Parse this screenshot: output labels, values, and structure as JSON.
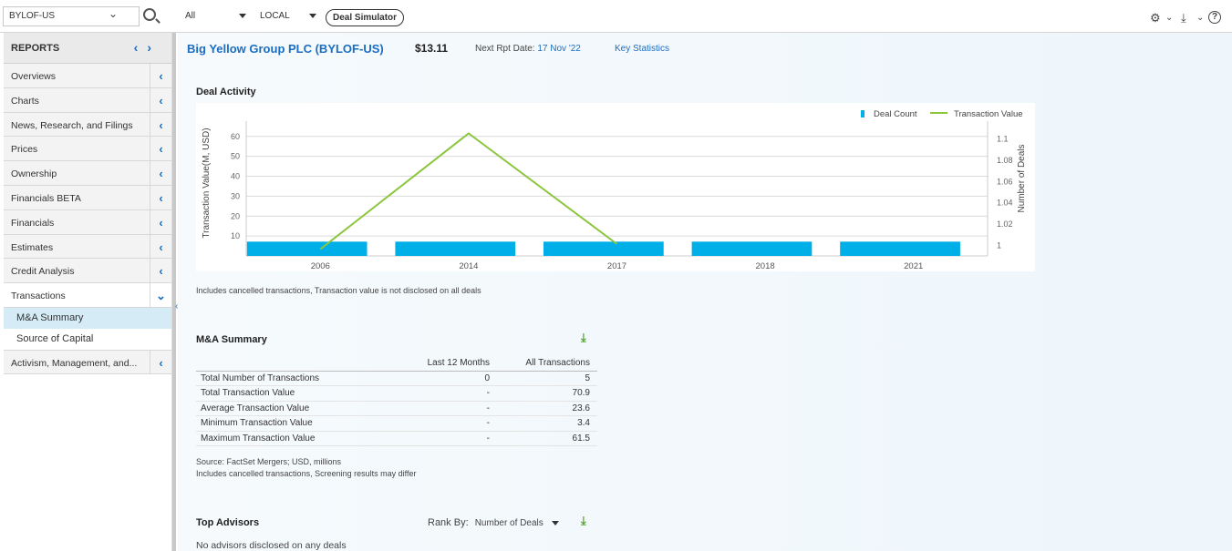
{
  "topbar": {
    "ticker": "BYLOF-US",
    "filter_all": "All",
    "filter_local": "LOCAL",
    "deal_simulator": "Deal Simulator"
  },
  "sidebar": {
    "heading": "REPORTS",
    "items": [
      {
        "label": "Overviews"
      },
      {
        "label": "Charts"
      },
      {
        "label": "News, Research, and Filings"
      },
      {
        "label": "Prices"
      },
      {
        "label": "Ownership"
      },
      {
        "label": "Financials BETA"
      },
      {
        "label": "Financials"
      },
      {
        "label": "Estimates"
      },
      {
        "label": "Credit Analysis"
      },
      {
        "label": "Transactions"
      }
    ],
    "subitems": [
      {
        "label": "M&A Summary"
      },
      {
        "label": "Source of Capital"
      }
    ],
    "last_item": "Activism, Management, and..."
  },
  "header": {
    "company": "Big Yellow Group PLC (BYLOF-US)",
    "price": "$13.11",
    "rpt_label": "Next Rpt Date:",
    "rpt_date": "17 Nov '22",
    "key_stats": "Key Statistics"
  },
  "deal_activity": {
    "title": "Deal Activity",
    "note": "Includes cancelled transactions, Transaction value is not disclosed on all deals"
  },
  "chart_data": {
    "type": "bar",
    "categories": [
      "2006",
      "2014",
      "2017",
      "2018",
      "2021"
    ],
    "series": [
      {
        "name": "Deal Count",
        "type": "bar",
        "axis": "right",
        "values": [
          1,
          1,
          1,
          1,
          1
        ],
        "color": "#00aee8"
      },
      {
        "name": "Transaction Value",
        "type": "line",
        "axis": "left",
        "values": [
          3.4,
          61.5,
          6.0,
          null,
          null
        ],
        "color": "#8cc63f"
      }
    ],
    "ylabel": "Transaction Value(M, USD)",
    "y2label": "Number of Deals",
    "yticks": [
      10,
      20,
      30,
      40,
      50,
      60
    ],
    "y2ticks": [
      "1",
      "1.02",
      "1.04",
      "1.06",
      "1.08",
      "1.1"
    ],
    "ylim": [
      0,
      64
    ],
    "y2lim": [
      0.99,
      1.11
    ],
    "legend": "top-right",
    "grid": true
  },
  "ma_summary": {
    "title": "M&A Summary",
    "columns": [
      "",
      "Last 12 Months",
      "All Transactions"
    ],
    "rows": [
      [
        "Total Number of Transactions",
        "0",
        "5"
      ],
      [
        "Total Transaction Value",
        "-",
        "70.9"
      ],
      [
        "Average Transaction Value",
        "-",
        "23.6"
      ],
      [
        "Minimum Transaction Value",
        "-",
        "3.4"
      ],
      [
        "Maximum Transaction Value",
        "-",
        "61.5"
      ]
    ],
    "source": "Source: FactSet Mergers; USD, millions",
    "note": "Includes cancelled transactions, Screening results may differ"
  },
  "top_advisors": {
    "title": "Top Advisors",
    "rank_label": "Rank By:",
    "rank_value": "Number of Deals",
    "empty": "No advisors disclosed on any deals"
  }
}
